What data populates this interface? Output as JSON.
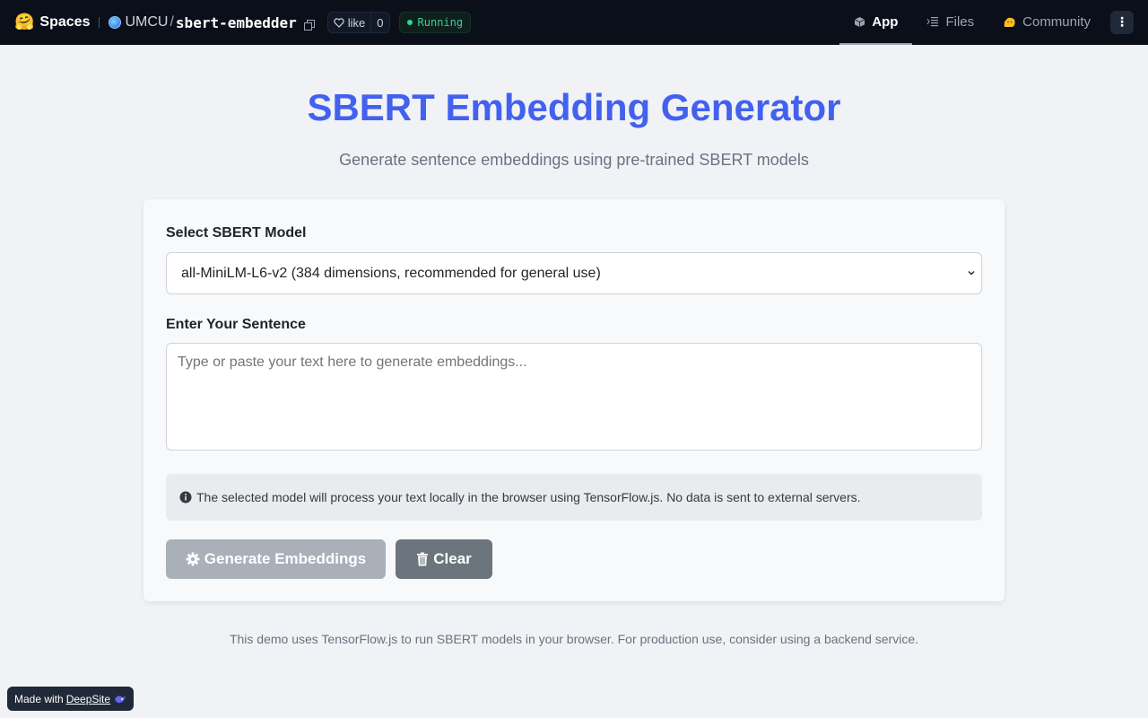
{
  "topbar": {
    "brand_emoji": "🤗",
    "brand_label": "Spaces",
    "org": "UMCU",
    "slash": "/",
    "repo": "sbert-embedder",
    "like_label": "like",
    "like_count": "0",
    "status": "Running",
    "status_color": "#34d399"
  },
  "nav": {
    "tabs": [
      {
        "label": "App",
        "icon": "cube-icon",
        "active": true
      },
      {
        "label": "Files",
        "icon": "files-icon",
        "active": false
      },
      {
        "label": "Community",
        "icon": "community-icon",
        "active": false
      }
    ],
    "menu_glyph": "⋮"
  },
  "main": {
    "title": "SBERT Embedding Generator",
    "subtitle": "Generate sentence embeddings using pre-trained SBERT models",
    "title_color": "#4361ee"
  },
  "form": {
    "model_label": "Select SBERT Model",
    "model_selected": "all-MiniLM-L6-v2 (384 dimensions, recommended for general use)",
    "sentence_label": "Enter Your Sentence",
    "sentence_placeholder": "Type or paste your text here to generate embeddings...",
    "sentence_value": "",
    "info_text": "The selected model will process your text locally in the browser using TensorFlow.js. No data is sent to external servers.",
    "generate_label": "Generate Embeddings",
    "clear_label": "Clear"
  },
  "footer": {
    "note": "This demo uses TensorFlow.js to run SBERT models in your browser. For production use, consider using a backend service."
  },
  "badge": {
    "prefix": "Made with",
    "link": "DeepSite"
  }
}
